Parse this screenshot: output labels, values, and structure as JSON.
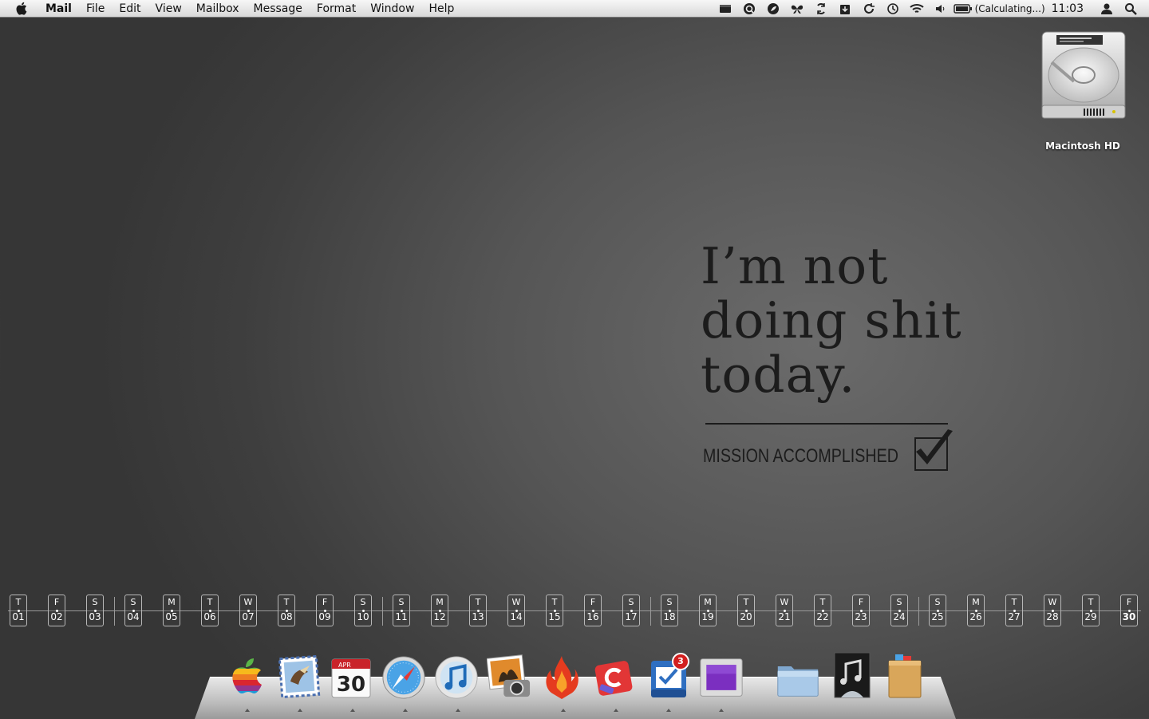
{
  "menubar": {
    "app_name": "Mail",
    "menus": [
      "File",
      "Edit",
      "View",
      "Mailbox",
      "Message",
      "Format",
      "Window",
      "Help"
    ],
    "battery_status": "(Calculating...)",
    "clock": "11:03"
  },
  "desktop": {
    "drive_label": "Macintosh HD"
  },
  "wallpaper": {
    "quote": "I’m not\ndoing shit\ntoday.",
    "tagline": "MISSION ACCOMPLISHED"
  },
  "calendar": {
    "days": [
      {
        "w": "T",
        "d": "01"
      },
      {
        "w": "F",
        "d": "02"
      },
      {
        "w": "S",
        "d": "03"
      },
      {
        "w": "S",
        "d": "04"
      },
      {
        "w": "M",
        "d": "05"
      },
      {
        "w": "T",
        "d": "06"
      },
      {
        "w": "W",
        "d": "07"
      },
      {
        "w": "T",
        "d": "08"
      },
      {
        "w": "F",
        "d": "09"
      },
      {
        "w": "S",
        "d": "10"
      },
      {
        "w": "S",
        "d": "11"
      },
      {
        "w": "M",
        "d": "12"
      },
      {
        "w": "T",
        "d": "13"
      },
      {
        "w": "W",
        "d": "14"
      },
      {
        "w": "T",
        "d": "15"
      },
      {
        "w": "F",
        "d": "16"
      },
      {
        "w": "S",
        "d": "17"
      },
      {
        "w": "S",
        "d": "18"
      },
      {
        "w": "M",
        "d": "19"
      },
      {
        "w": "T",
        "d": "20"
      },
      {
        "w": "W",
        "d": "21"
      },
      {
        "w": "T",
        "d": "22"
      },
      {
        "w": "F",
        "d": "23"
      },
      {
        "w": "S",
        "d": "24"
      },
      {
        "w": "S",
        "d": "25"
      },
      {
        "w": "M",
        "d": "26"
      },
      {
        "w": "T",
        "d": "27"
      },
      {
        "w": "W",
        "d": "28"
      },
      {
        "w": "T",
        "d": "29"
      },
      {
        "w": "F",
        "d": "30"
      }
    ],
    "today": "30"
  },
  "dock": {
    "items": [
      {
        "name": "apple-icon",
        "running": true
      },
      {
        "name": "mail-icon",
        "running": true
      },
      {
        "name": "ical-icon",
        "running": true,
        "month": "APR",
        "date": "30"
      },
      {
        "name": "safari-icon",
        "running": true
      },
      {
        "name": "itunes-icon",
        "running": true
      },
      {
        "name": "iphoto-icon",
        "running": false
      },
      {
        "name": "fire-app-icon",
        "running": true
      },
      {
        "name": "c-app-icon",
        "running": true
      },
      {
        "name": "things-icon",
        "running": true,
        "badge": "3"
      },
      {
        "name": "purple-app-icon",
        "running": true
      },
      {
        "name": "applications-folder-icon",
        "running": false
      },
      {
        "name": "music-folder-icon",
        "running": false
      },
      {
        "name": "documents-stack-icon",
        "running": false
      }
    ]
  },
  "colors": {
    "wallpaper_text": "#1c1c1c",
    "badge_red": "#d21f1f"
  }
}
